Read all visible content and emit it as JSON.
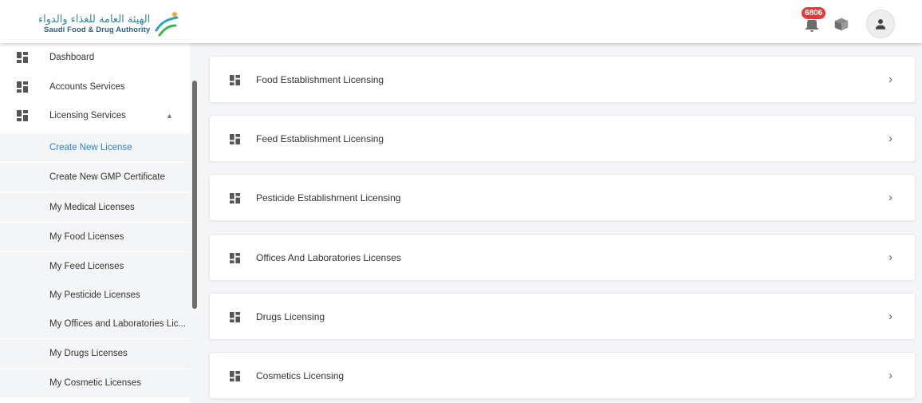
{
  "header": {
    "logo_ar": "الهيئة العامة للغذاء والدواء",
    "logo_en": "Saudi Food & Drug Authority",
    "notification_count": "6806",
    "icons": [
      "bell-icon",
      "package-icon",
      "user-icon"
    ]
  },
  "sidebar": {
    "items": [
      {
        "label": "Dashboard",
        "icon": "dashboard-icon"
      },
      {
        "label": "Accounts Services",
        "icon": "dashboard-icon"
      },
      {
        "label": "Licensing Services",
        "icon": "dashboard-icon",
        "expanded": true
      }
    ],
    "sub_items": [
      {
        "label": "Create New License",
        "active": true
      },
      {
        "label": "Create New GMP Certificate"
      },
      {
        "label": "My Medical Licenses"
      },
      {
        "label": "My Food Licenses"
      },
      {
        "label": "My Feed Licenses"
      },
      {
        "label": "My Pesticide Licenses"
      },
      {
        "label": "My Offices and Laboratories Lic..."
      },
      {
        "label": "My Drugs Licenses"
      },
      {
        "label": "My Cosmetic Licenses"
      }
    ]
  },
  "main": {
    "cards": [
      {
        "label": "Food Establishment Licensing"
      },
      {
        "label": "Feed Establishment Licensing"
      },
      {
        "label": "Pesticide Establishment Licensing"
      },
      {
        "label": "Offices And Laboratories Licenses"
      },
      {
        "label": "Drugs Licensing"
      },
      {
        "label": "Cosmetics Licensing"
      }
    ]
  },
  "colors": {
    "accent_link": "#2f7fd6",
    "badge": "#e53935",
    "background": "#f4f5f7"
  }
}
